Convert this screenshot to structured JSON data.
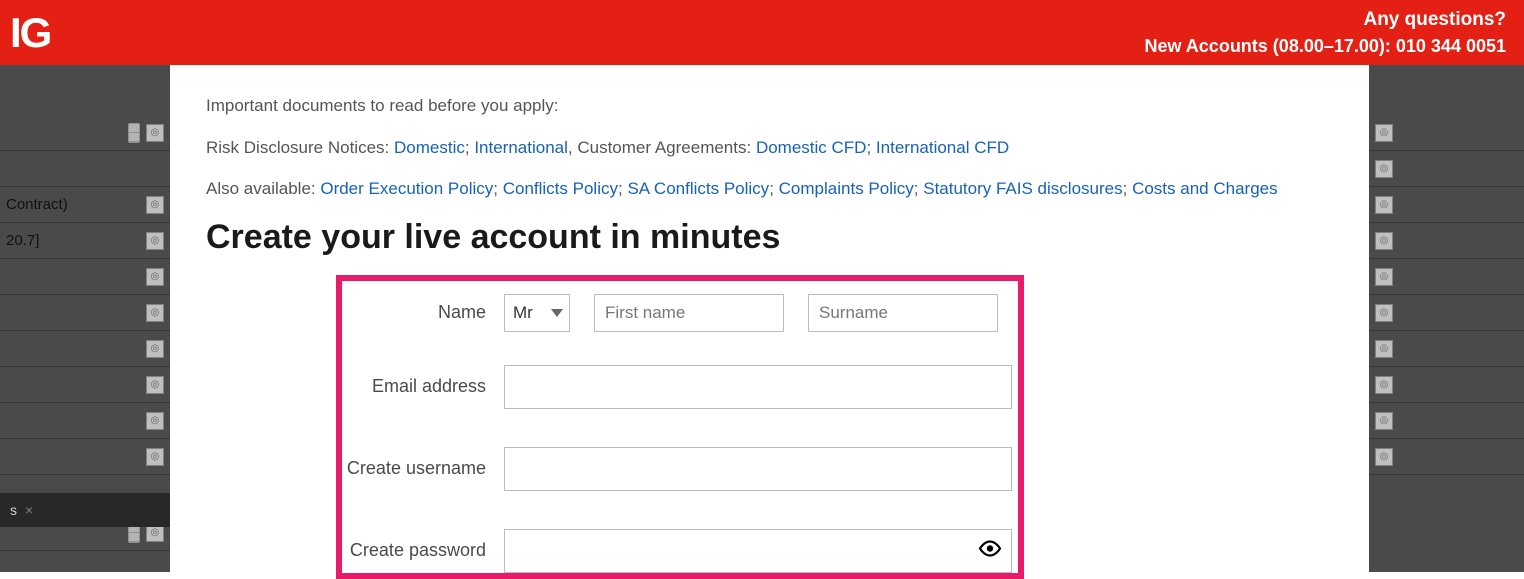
{
  "header": {
    "logo": "IG",
    "questions": "Any questions?",
    "new_accounts": "New Accounts (08.00–17.00): 010 344 0051"
  },
  "intro": {
    "line1_prefix": "Important documents to read before you apply:",
    "line2_prefix": "Risk Disclosure Notices: ",
    "link_domestic": "Domestic",
    "sep_semi": ";",
    "link_international": "International",
    "line2_mid": ", Customer Agreements: ",
    "link_dom_cfd": "Domestic CFD",
    "link_int_cfd": "International CFD",
    "line3_prefix": "Also available: ",
    "link_oep": "Order Execution Policy",
    "link_conflicts": "Conflicts Policy",
    "link_sa_conflicts": "SA Conflicts Policy",
    "link_complaints": "Complaints Policy",
    "link_fais": "Statutory FAIS disclosures",
    "link_costs": "Costs and Charges"
  },
  "title": "Create your live account in minutes",
  "form": {
    "name_label": "Name",
    "title_value": "Mr",
    "first_name_placeholder": "First name",
    "surname_placeholder": "Surname",
    "email_label": "Email address",
    "username_label": "Create username",
    "password_label": "Create password"
  },
  "bg": {
    "row_contract": "Contract)",
    "row_price": "20.7]",
    "tab_label": "s",
    "tab_close": "×"
  }
}
